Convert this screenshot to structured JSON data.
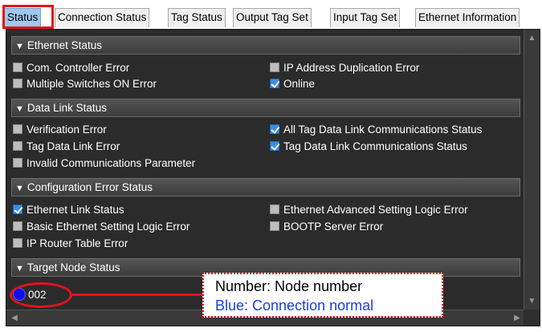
{
  "tabs": [
    {
      "label": "Status",
      "active": true
    },
    {
      "label": "Connection Status",
      "active": false
    },
    {
      "label": "Tag Status",
      "active": false
    },
    {
      "label": "Output Tag Set",
      "active": false
    },
    {
      "label": "Input Tag Set",
      "active": false
    },
    {
      "label": "Ethernet Information",
      "active": false
    }
  ],
  "sections": {
    "ethernet_status": {
      "title": "Ethernet Status",
      "items": [
        {
          "label": "Com. Controller Error",
          "checked": false
        },
        {
          "label": "IP Address Duplication Error",
          "checked": false
        },
        {
          "label": "Multiple Switches ON Error",
          "checked": false
        },
        {
          "label": "Online",
          "checked": true
        }
      ]
    },
    "data_link_status": {
      "title": "Data Link Status",
      "items": [
        {
          "label": "Verification Error",
          "checked": false
        },
        {
          "label": "All Tag Data Link Communications Status",
          "checked": true
        },
        {
          "label": "Tag Data Link Error",
          "checked": false
        },
        {
          "label": "Tag Data Link Communications Status",
          "checked": true
        },
        {
          "label": "Invalid Communications Parameter",
          "checked": false
        }
      ]
    },
    "configuration_error_status": {
      "title": "Configuration Error Status",
      "items": [
        {
          "label": "Ethernet Link Status",
          "checked": true
        },
        {
          "label": "Ethernet Advanced Setting Logic Error",
          "checked": false
        },
        {
          "label": "Basic Ethernet Setting Logic Error",
          "checked": false
        },
        {
          "label": "BOOTP Server Error",
          "checked": false
        },
        {
          "label": "IP Router Table Error",
          "checked": false
        }
      ]
    },
    "target_node_status": {
      "title": "Target Node Status",
      "node": {
        "number": "002",
        "color": "#1010e6"
      }
    }
  },
  "callout": {
    "line1": "Number: Node number",
    "line2": "Blue: Connection normal"
  },
  "colors": {
    "annotation_red": "#e0141c",
    "checked_blue": "#3b8ee6",
    "active_tab": "#9ec8ec",
    "panel_bg": "#2b2b2b"
  }
}
